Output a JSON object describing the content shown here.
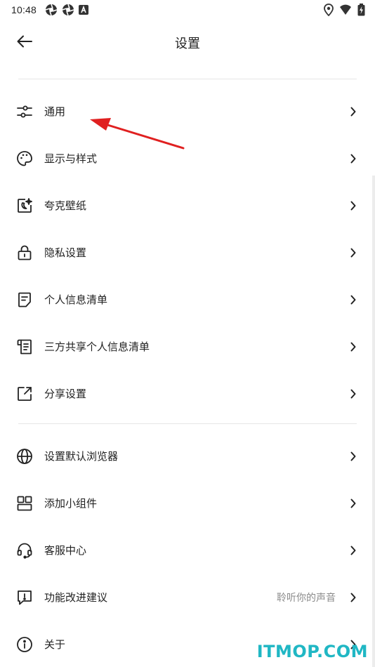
{
  "status_bar": {
    "time": "10:48",
    "left_icons": [
      "aperture-icon",
      "aperture-icon",
      "a-badge-icon"
    ],
    "right_icons": [
      "location-icon",
      "wifi-icon",
      "battery-charging-icon"
    ]
  },
  "header": {
    "title": "设置",
    "back_icon": "arrow-left-icon"
  },
  "sections": [
    {
      "items": [
        {
          "id": "general",
          "label": "通用",
          "icon": "sliders-icon"
        },
        {
          "id": "display",
          "label": "显示与样式",
          "icon": "palette-icon"
        },
        {
          "id": "wallpaper",
          "label": "夸克壁纸",
          "icon": "moon-star-icon"
        },
        {
          "id": "privacy",
          "label": "隐私设置",
          "icon": "lock-icon"
        },
        {
          "id": "personal-info",
          "label": "个人信息清单",
          "icon": "document-icon"
        },
        {
          "id": "third-party-info",
          "label": "三方共享个人信息清单",
          "icon": "scroll-icon"
        },
        {
          "id": "share",
          "label": "分享设置",
          "icon": "share-edit-icon"
        }
      ]
    },
    {
      "items": [
        {
          "id": "default-browser",
          "label": "设置默认浏览器",
          "icon": "globe-icon"
        },
        {
          "id": "widget",
          "label": "添加小组件",
          "icon": "widget-icon"
        },
        {
          "id": "support",
          "label": "客服中心",
          "icon": "headset-icon"
        },
        {
          "id": "feedback",
          "label": "功能改进建议",
          "value": "聆听你的声音",
          "icon": "feedback-icon"
        },
        {
          "id": "about",
          "label": "关于",
          "icon": "info-icon"
        }
      ]
    }
  ],
  "annotation": {
    "type": "red-arrow",
    "color": "#e02020"
  },
  "watermark": "ITMOP.COM",
  "colors": {
    "text": "#222222",
    "secondary": "#8a8a8a",
    "divider": "#e6e6e6",
    "watermark": "#20b7c4"
  }
}
